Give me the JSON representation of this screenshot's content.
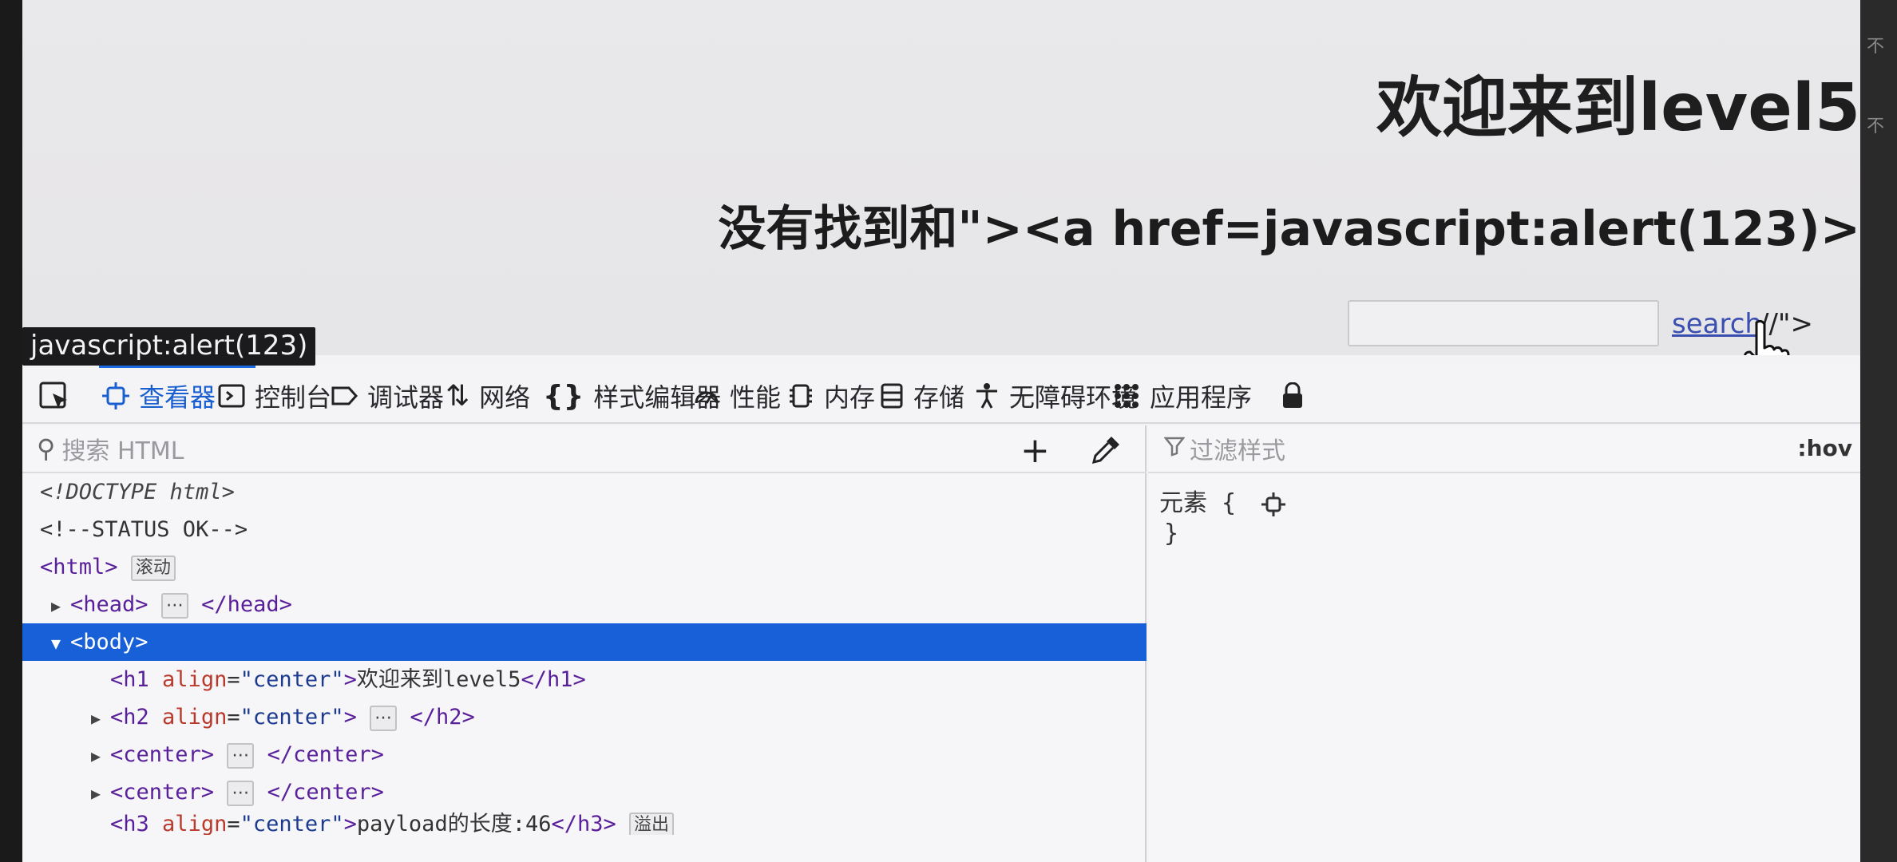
{
  "page": {
    "h1": "欢迎来到level5",
    "h2": "没有找到和\"><a href=javascript:alert(123)>",
    "search_input_value": "",
    "search_link": "search",
    "after_link_text": "//\">",
    "link_tooltip": "javascript:alert(123)"
  },
  "devtools": {
    "tabs": [
      {
        "label": "查看器",
        "icon": "inspector-icon"
      },
      {
        "label": "控制台",
        "icon": "console-icon"
      },
      {
        "label": "调试器",
        "icon": "debugger-icon"
      },
      {
        "label": "网络",
        "icon": "network-icon"
      },
      {
        "label": "样式编辑器",
        "icon": "style-editor-icon"
      },
      {
        "label": "性能",
        "icon": "performance-icon"
      },
      {
        "label": "内存",
        "icon": "memory-icon"
      },
      {
        "label": "存储",
        "icon": "storage-icon"
      },
      {
        "label": "无障碍环境",
        "icon": "accessibility-icon"
      },
      {
        "label": "应用程序",
        "icon": "application-icon"
      }
    ],
    "active_tab": "查看器",
    "search_html_placeholder": "搜索 HTML",
    "filter_styles_placeholder": "过滤样式",
    "hov_label": ":hov",
    "element_rule_open": "元素 {",
    "element_rule_close": "}",
    "tree": {
      "doctype": "<!DOCTYPE html>",
      "comment": "<!--STATUS OK-->",
      "html_open": "<html>",
      "html_badge": "滚动",
      "head_open": "<head>",
      "head_close": "</head>",
      "body_open": "<body>",
      "h1_open": "<h1",
      "h1_attr": "align",
      "h1_val": "\"center\"",
      "h1_text": "欢迎来到level5",
      "h1_close": "</h1>",
      "h2_open": "<h2",
      "h2_attr": "align",
      "h2_val": "\"center\"",
      "h2_close": "</h2>",
      "center_open": "<center>",
      "center_close": "</center>",
      "h3_open": "<h3",
      "h3_attr": "align",
      "h3_val": "\"center\"",
      "h3_text": "payload的长度:46",
      "h3_close": "</h3>",
      "h3_badge": "溢出",
      "ellipsis": "⋯"
    }
  }
}
